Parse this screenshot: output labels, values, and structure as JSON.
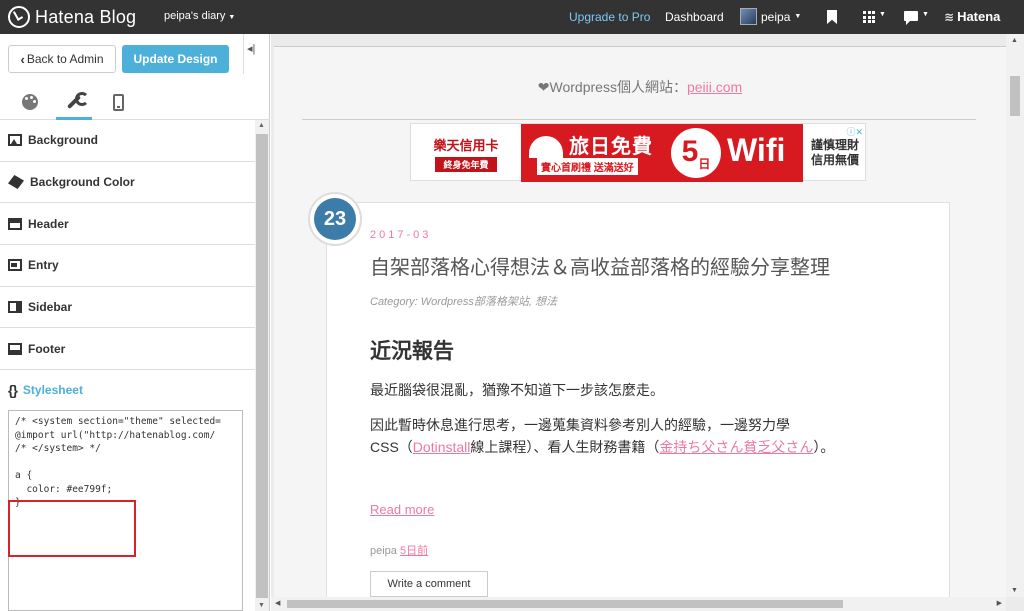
{
  "topbar": {
    "logo_text": "Hatena Blog",
    "blog_name": "peipa's diary",
    "upgrade": "Upgrade to Pro",
    "dashboard": "Dashboard",
    "username": "peipa",
    "brand": "Hatena"
  },
  "sidebar": {
    "back_label": "Back to Admin",
    "update_label": "Update Design",
    "collapse_glyph": "◂|",
    "items": [
      {
        "label": "Background",
        "icon": "image-icon"
      },
      {
        "label": "Background Color",
        "icon": "paint-bucket-icon"
      },
      {
        "label": "Header",
        "icon": "header-layout-icon"
      },
      {
        "label": "Entry",
        "icon": "entry-layout-icon"
      },
      {
        "label": "Sidebar",
        "icon": "sidebar-layout-icon"
      },
      {
        "label": "Footer",
        "icon": "footer-layout-icon"
      }
    ],
    "stylesheet_label": "Stylesheet",
    "editor_text": "/* <system section=\"theme\" selected=\n@import url(\"http://hatenablog.com/\n/* </system> */\n\na {\n  color: #ee799f;\n}"
  },
  "preview": {
    "notice_prefix": "❤Wordpress個人網站：",
    "notice_link": "peiii.com",
    "ad": {
      "brand": "樂天信用卡",
      "sub": "終身免年費",
      "title": "旅日免費",
      "tag": "實心首刷禮 送滿送好",
      "five": "5",
      "five_unit": "日",
      "wifi": "Wifi",
      "right_line1": "謹慎理財",
      "right_line2": "信用無價",
      "choices": "ⓘ✕"
    },
    "badge": "23",
    "post": {
      "date": "2017-03",
      "title": "自架部落格心得想法＆高收益部落格的經驗分享整理",
      "category": "Category: Wordpress部落格架站, 想法",
      "heading": "近況報告",
      "p1": "最近腦袋很混亂，猶豫不知道下一步該怎麼走。",
      "p2_a": "因此暫時休息進行思考，一邊蒐集資料參考別人的經驗，一邊努力學",
      "p2_b": "CSS（",
      "p2_link1": "Dotinstall",
      "p2_c": "線上課程）、看人生財務書籍（",
      "p2_link2": "金持ち父さん貧乏父さん",
      "p2_d": "）。",
      "read_more": "Read more",
      "author": "peipa",
      "time": "5日前",
      "write_comment": "Write a comment"
    }
  },
  "colors": {
    "topbar": "#333333",
    "accent": "#4db0d8",
    "link": "#ee799f",
    "badge": "#3d7ba9",
    "highlight": "#d9232b"
  }
}
